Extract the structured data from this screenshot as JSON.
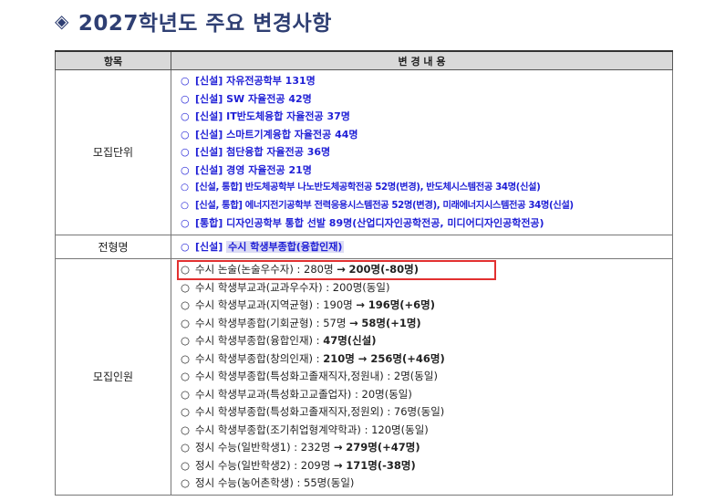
{
  "title": "2027학년도 주요 변경사항",
  "title_icon": "diamond-icon",
  "headers": {
    "col1": "항목",
    "col2": "변 경 내 용"
  },
  "rows": {
    "recruit_unit": {
      "label": "모집단위",
      "items": [
        "[신설] 자유전공학부 131명",
        "[신설] SW 자율전공 42명",
        "[신설] IT반도체융합 자율전공 37명",
        "[신설] 스마트기계융합 자율전공 44명",
        "[신설] 첨단융합 자율전공 36명",
        "[신설] 경영 자율전공 21명",
        "[신설, 통합] 반도체공학부 나노반도체공학전공 52명(변경), 반도체시스템전공 34명(신설)",
        "[신설, 통합] 에너지전기공학부 전력응용시스템전공 52명(변경), 미래에너지시스템전공 34명(신설)",
        "[통합] 디자인공학부 통합 선발 89명(산업디자인공학전공, 미디어디자인공학전공)"
      ]
    },
    "admission_type": {
      "label": "전형명",
      "prefix": "[신설]",
      "highlight": "수시 학생부종합(융합인재)"
    },
    "recruit_count": {
      "label": "모집인원",
      "items": [
        {
          "text": "수시 논술(논술우수자) : 280명",
          "arrow": "→",
          "bold": "200명(-80명)"
        },
        {
          "text": "수시 학생부교과(교과우수자) : 200명(동일)",
          "arrow": "",
          "bold": ""
        },
        {
          "text": "수시 학생부교과(지역균형) : 190명",
          "arrow": "→",
          "bold": "196명(+6명)"
        },
        {
          "text": "수시 학생부종합(기회균형) : 57명",
          "arrow": "→",
          "bold": "58명(+1명)"
        },
        {
          "text": "수시 학생부종합(융합인재) :",
          "arrow": "",
          "bold": "47명(신설)"
        },
        {
          "text": "수시 학생부종합(창의인재) :",
          "arrow": "",
          "bold": "210명 → 256명(+46명)"
        },
        {
          "text": "수시 학생부종합(특성화고졸재직자,정원내) : 2명(동일)",
          "arrow": "",
          "bold": ""
        },
        {
          "text": "수시 학생부교과(특성화고교졸업자) : 20명(동일)",
          "arrow": "",
          "bold": ""
        },
        {
          "text": "수시 학생부종합(특성화고졸재직자,정원외) : 76명(동일)",
          "arrow": "",
          "bold": ""
        },
        {
          "text": "수시 학생부종합(조기취업형계약학과) : 120명(동일)",
          "arrow": "",
          "bold": ""
        },
        {
          "text": "정시 수능(일반학생1) : 232명",
          "arrow": "→",
          "bold": "279명(+47명)"
        },
        {
          "text": "정시 수능(일반학생2) : 209명",
          "arrow": "→",
          "bold": "171명(-38명)"
        },
        {
          "text": "정시 수능(농어촌학생) : 55명(동일)",
          "arrow": "",
          "bold": ""
        }
      ]
    }
  }
}
